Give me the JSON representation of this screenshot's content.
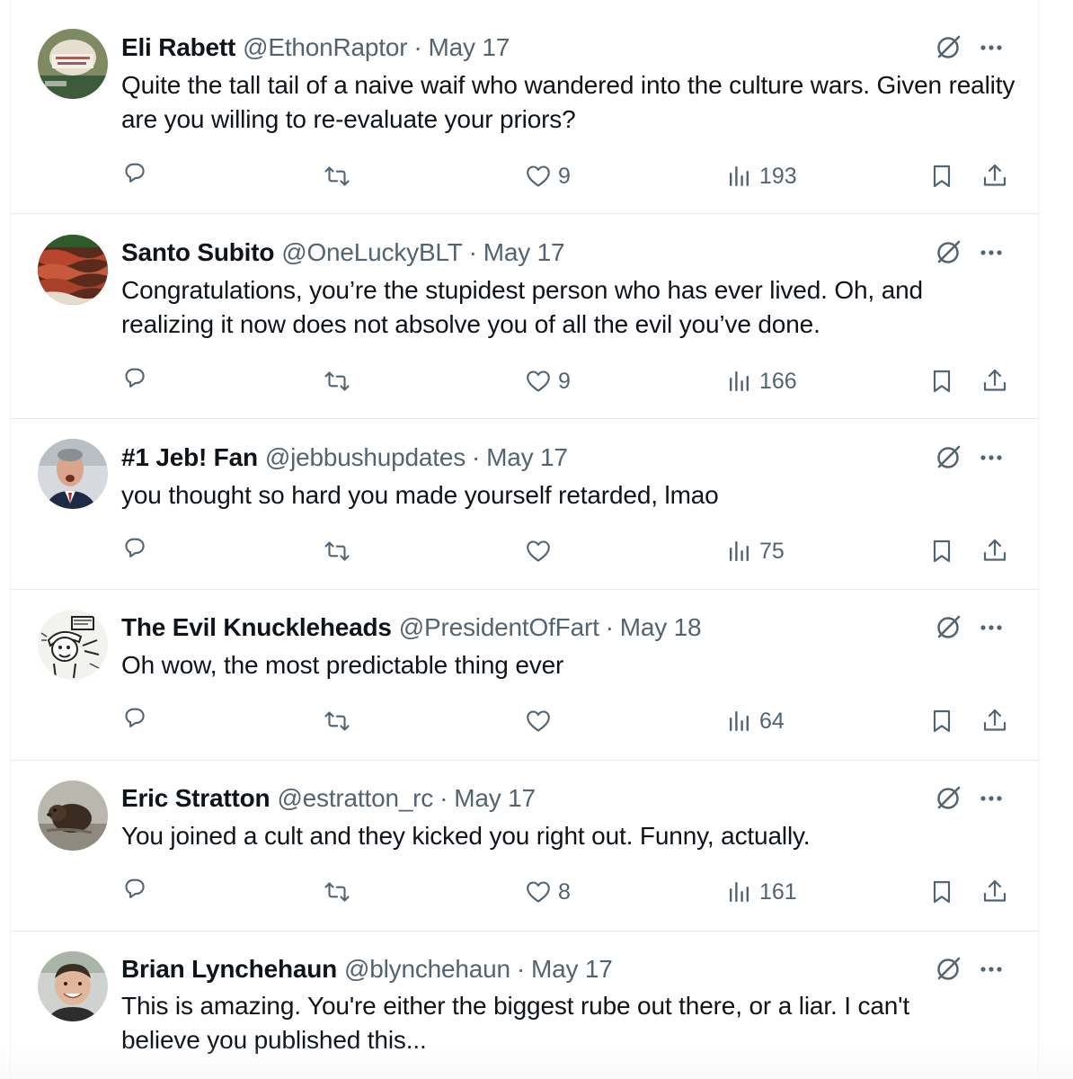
{
  "tweets": [
    {
      "name": "Eli Rabett",
      "handle": "@EthonRaptor",
      "separator": "·",
      "date": "May 17",
      "text": "Quite the tall tail of a naive waif who wandered into the culture wars. Given reality are you willing to re-evaluate your priors?",
      "likes": "9",
      "views": "193"
    },
    {
      "name": "Santo Subito",
      "handle": "@OneLuckyBLT",
      "separator": "·",
      "date": "May 17",
      "text": "Congratulations, you’re the stupidest person who has ever lived. Oh, and realizing it now does not absolve you of all the evil you’ve done.",
      "likes": "9",
      "views": "166"
    },
    {
      "name": "#1 Jeb! Fan",
      "handle": "@jebbushupdates",
      "separator": "·",
      "date": "May 17",
      "text": "you thought so hard you made yourself retarded, lmao",
      "likes": "",
      "views": "75"
    },
    {
      "name": "The Evil Knuckleheads",
      "handle": "@PresidentOfFart",
      "separator": "·",
      "date": "May 18",
      "text": "Oh wow, the most predictable thing ever",
      "likes": "",
      "views": "64"
    },
    {
      "name": "Eric Stratton",
      "handle": "@estratton_rc",
      "separator": "·",
      "date": "May 17",
      "text": "You joined a cult and they kicked you right out. Funny, actually.",
      "likes": "8",
      "views": "161"
    },
    {
      "name": "Brian Lynchehaun",
      "handle": "@blynchehaun",
      "separator": "·",
      "date": "May 17",
      "text": "This is amazing. You're either the biggest rube out there, or a liar. I can't believe you published this...",
      "likes": "",
      "views": ""
    }
  ],
  "icons": {
    "reply": "reply-icon",
    "retweet": "retweet-icon",
    "like": "heart-icon",
    "views": "views-icon",
    "bookmark": "bookmark-icon",
    "share": "share-icon",
    "grok": "grok-icon",
    "more": "more-icon"
  },
  "colors": {
    "text": "#0f1419",
    "secondary": "#536471",
    "border": "#eff3f4"
  }
}
